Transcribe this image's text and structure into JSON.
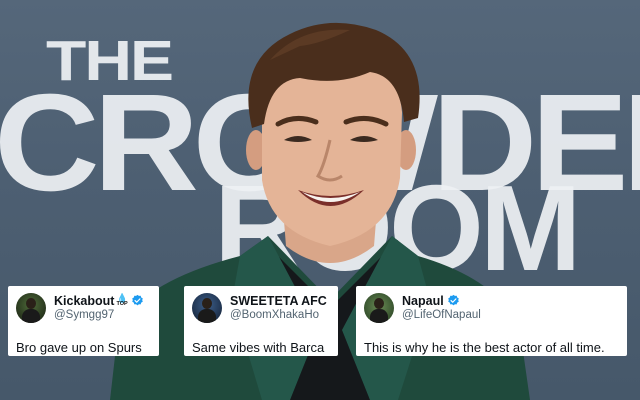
{
  "backdrop": {
    "line1": "THE",
    "line2": "CROWDED",
    "line3": "ROOM"
  },
  "tweets": [
    {
      "name": "Kickabout",
      "handle": "@Symgg97",
      "text": "Bro gave up on Spurs",
      "name_emoji": "TOP",
      "verified": true
    },
    {
      "name": "SWEETETA AFC",
      "handle": "@BoomXhakaHo",
      "text": "Same vibes with Barca",
      "verified": false
    },
    {
      "name": "Napaul",
      "handle": "@LifeOfNapaul",
      "text": "This is why he is the best actor of all time.",
      "verified": true
    }
  ],
  "colors": {
    "verified_badge": "#1d9bf0",
    "suit": "#1f4a3c",
    "backdrop": "#4d5f72"
  }
}
